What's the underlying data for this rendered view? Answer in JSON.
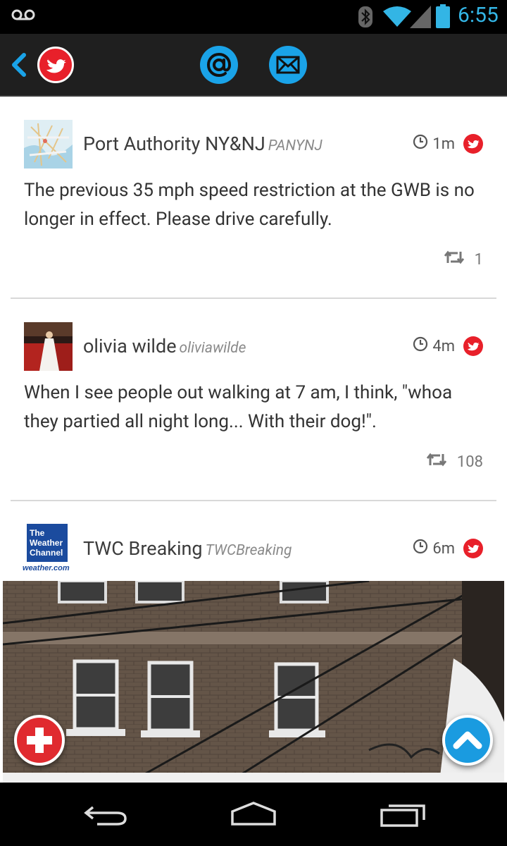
{
  "status_bar": {
    "time": "6:55",
    "icons": [
      "voicemail-icon",
      "bluetooth-icon",
      "wifi-icon",
      "signal-icon",
      "battery-icon"
    ],
    "accent_color": "#33b5e5"
  },
  "action_bar": {
    "back_icon": "chevron-left-icon",
    "account_icon": "twitter-bird-icon",
    "tabs": [
      {
        "icon": "at-mention-icon"
      },
      {
        "icon": "envelope-icon"
      }
    ],
    "tab_color": "#1aa3e8",
    "brand_red": "#e8202a"
  },
  "tweets": [
    {
      "name": "Port Authority NY&NJ",
      "handle": "PANYNJ",
      "time": "1m",
      "text": "The previous 35 mph speed restriction at the GWB is no longer in effect.  Please drive carefully.",
      "retweets": "1"
    },
    {
      "name": "olivia wilde",
      "handle": "oliviawilde",
      "time": "4m",
      "text": "When I see people out walking at 7 am, I think, \"whoa they partied all night long... With their dog!\".",
      "retweets": "108"
    },
    {
      "name": "TWC Breaking",
      "handle": "TWCBreaking",
      "time": "6m",
      "avatar_text": {
        "line1": "The",
        "line2": "Weather",
        "line3": "Channel",
        "site": "weather.com"
      }
    }
  ],
  "fab": {
    "add_icon": "plus-icon",
    "scroll_top_icon": "chevron-up-icon"
  },
  "nav_bar": {
    "icons": [
      "back-icon",
      "home-icon",
      "recent-apps-icon"
    ]
  }
}
